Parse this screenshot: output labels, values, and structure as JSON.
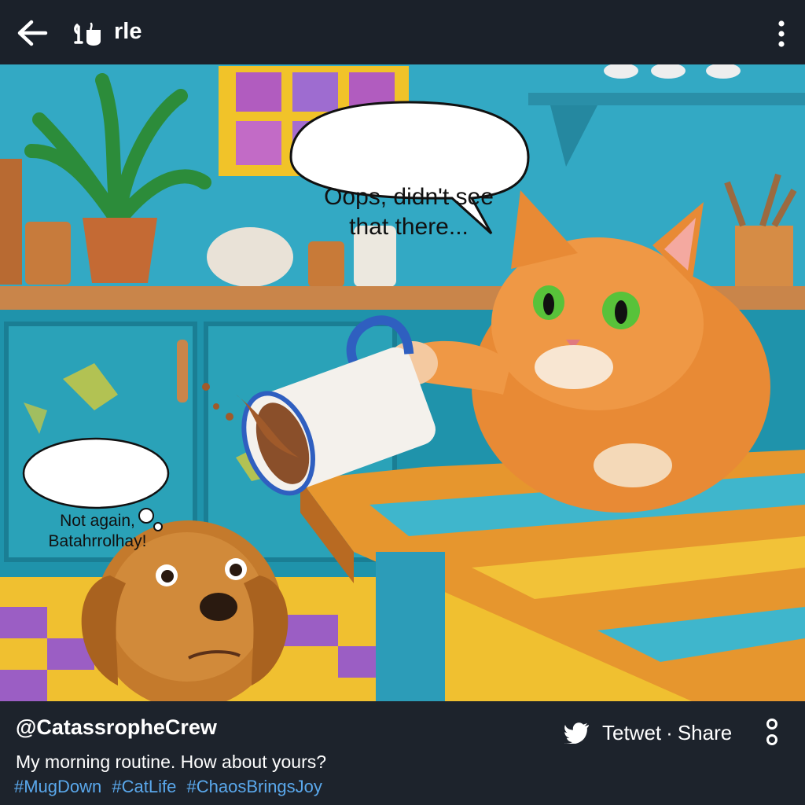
{
  "header": {
    "back_icon": "arrow-left-icon",
    "logo_icon": "app-logo-icon",
    "title": "rle",
    "menu_icon": "vertical-dots-icon"
  },
  "image": {
    "description_icon": "cat-knocking-mug-illustration",
    "cat_speech": [
      "Oops, didn't see",
      "that there..."
    ],
    "dog_thought": [
      "Not again,",
      "Batahrrolhay!"
    ]
  },
  "post": {
    "handle": "@CatassropheCrew",
    "caption": "My morning routine. How about yours?",
    "hashtags": [
      "#MugDown",
      "#CatLife",
      "#ChaosBringsJoy"
    ],
    "retweet_icon": "bird-icon",
    "retweet_label": "Tetwet",
    "separator": "·",
    "share_label": "Share",
    "more_icon": "circle-dots-icon"
  },
  "colors": {
    "bar_bg": "#1b212a",
    "hashtag": "#5aa8ec",
    "wall": "#2fa4bd",
    "cat": "#e88a35"
  }
}
